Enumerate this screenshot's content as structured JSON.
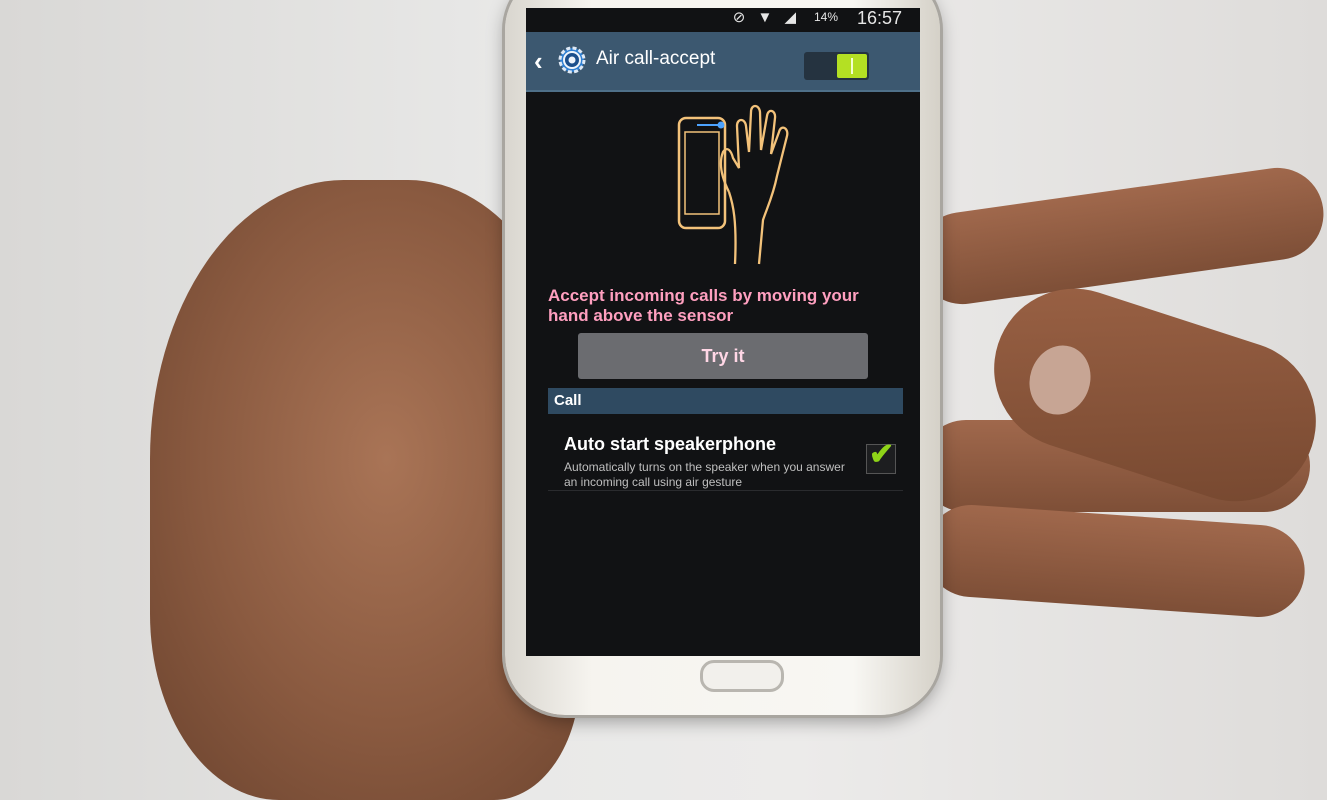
{
  "status_bar": {
    "icons": "⊘ ▼ ◢",
    "battery_percent": "14%",
    "time": "16:57"
  },
  "action_bar": {
    "title": "Air call-accept",
    "toggle_on": true,
    "toggle_color": "#b4e023"
  },
  "description": "Accept incoming calls by moving your hand above the sensor",
  "try_button_label": "Try it",
  "section": {
    "header": "Call",
    "setting": {
      "title": "Auto start speakerphone",
      "subtitle": "Automatically turns on the speaker when you answer an incoming call using air gesture",
      "checked": true,
      "check_glyph": "✔"
    }
  }
}
